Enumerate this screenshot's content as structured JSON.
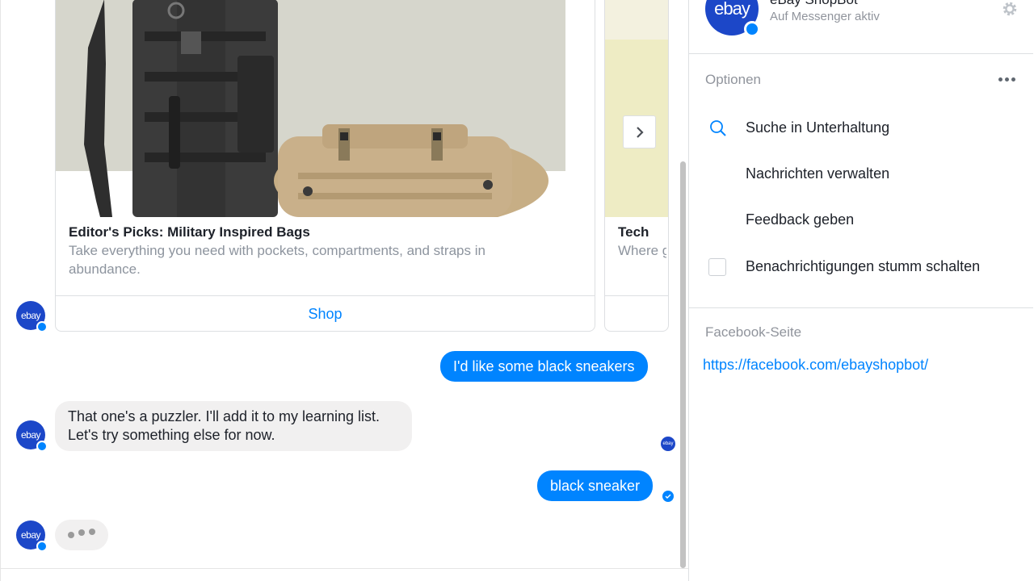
{
  "colors": {
    "accent": "#0084ff",
    "ebay_blue": "#1c47c8",
    "incoming_bubble": "#f1f0f0"
  },
  "cards": [
    {
      "title": "Editor's Picks: Military Inspired Bags",
      "subtitle": "Take everything you need with pockets, compartments, and straps in abundance.",
      "button": "Shop"
    },
    {
      "title": "Tech",
      "subtitle": "Where game"
    }
  ],
  "avatar_text": "ebay",
  "messages": [
    {
      "from": "user",
      "text": "I'd like some black sneakers"
    },
    {
      "from": "bot",
      "text": "That one's a puzzler. I'll add it to my learning list. Let's try something else for now."
    },
    {
      "from": "user",
      "text": "black sneaker"
    }
  ],
  "sidebar": {
    "name": "eBay ShopBot",
    "status": "Auf Messenger aktiv",
    "avatar_text": "ebay",
    "options_label": "Optionen",
    "options": [
      {
        "label": "Suche in Unterhaltung",
        "icon": "search-icon"
      },
      {
        "label": "Nachrichten verwalten"
      },
      {
        "label": "Feedback geben"
      },
      {
        "label": "Benachrichtigungen stumm schalten",
        "icon": "checkbox"
      }
    ],
    "facebook_label": "Facebook-Seite",
    "facebook_url": "https://facebook.com/ebayshopbot/"
  }
}
